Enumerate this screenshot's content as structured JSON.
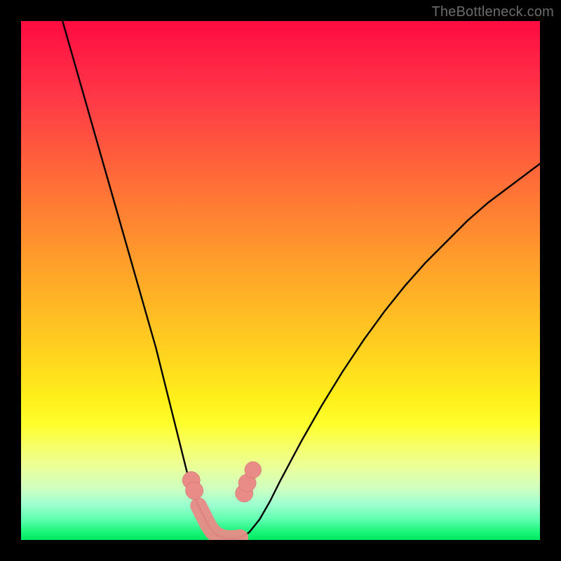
{
  "watermark": {
    "text": "TheBottleneck.com"
  },
  "colors": {
    "curve": "#000000",
    "marker_fill": "#e98b87",
    "marker_stroke": "#c96a66",
    "frame": "#000000"
  },
  "chart_data": {
    "type": "line",
    "title": "",
    "xlabel": "",
    "ylabel": "",
    "xlim": [
      0,
      100
    ],
    "ylim": [
      0,
      100
    ],
    "grid": false,
    "legend": false,
    "series": [
      {
        "name": "curve",
        "x": [
          8,
          10,
          12,
          14,
          16,
          18,
          20,
          22,
          24,
          26,
          27,
          28,
          29,
          30,
          31,
          32,
          33,
          34,
          35,
          36,
          37,
          38,
          39,
          40,
          41,
          42,
          43,
          44,
          46,
          48,
          50,
          54,
          58,
          62,
          66,
          70,
          74,
          78,
          82,
          86,
          90,
          94,
          98,
          100
        ],
        "y": [
          100,
          93,
          86,
          79,
          72,
          65,
          58,
          51,
          44,
          37,
          33,
          29,
          25,
          21,
          17,
          13,
          10,
          7,
          5,
          3,
          1.5,
          0.8,
          0.4,
          0.3,
          0.3,
          0.4,
          0.8,
          1.5,
          4,
          7.5,
          11.5,
          19,
          26,
          32.5,
          38.5,
          44,
          49,
          53.5,
          57.5,
          61.5,
          65,
          68,
          71,
          72.5
        ]
      }
    ],
    "markers": {
      "comment": "salmon bead markers placed along the curve near the trough",
      "points": [
        {
          "x": 32.8,
          "y": 11.5,
          "r": 1.7
        },
        {
          "x": 33.4,
          "y": 9.5,
          "r": 1.7
        },
        {
          "x": 43.0,
          "y": 9.0,
          "r": 1.7
        },
        {
          "x": 43.6,
          "y": 11.0,
          "r": 1.7
        },
        {
          "x": 44.7,
          "y": 13.5,
          "r": 1.6
        }
      ],
      "bottom_band": {
        "comment": "thick pink band along near-zero trough",
        "x_start": 34.2,
        "x_end": 42.2,
        "thickness": 3.2
      }
    }
  }
}
